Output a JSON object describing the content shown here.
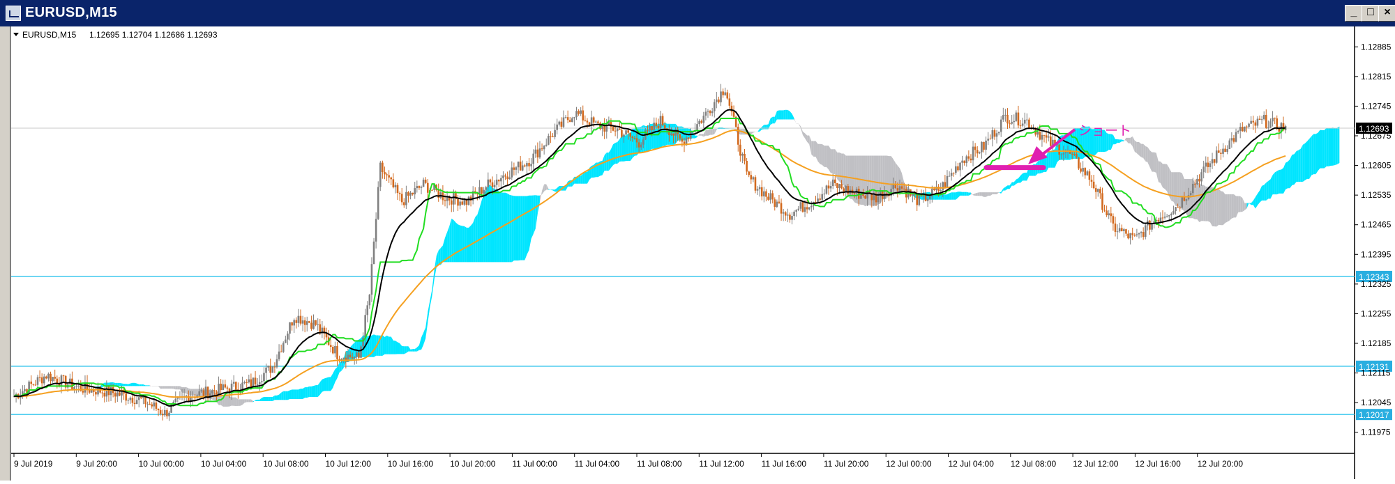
{
  "window": {
    "title": "EURUSD,M15",
    "buttons": [
      "_",
      "□",
      "×"
    ]
  },
  "chart_header": {
    "symbol": "EURUSD,M15",
    "ohlc": "1.12695 1.12704 1.12686 1.12693"
  },
  "annotation": {
    "text": "ショート",
    "color": "#e020b0"
  },
  "colors": {
    "bull_candle": "#808080",
    "bear_candle": "#d2691e",
    "kumo_bull": "#00e5ff",
    "kumo_bear": "#c0c0c4",
    "tenkan": "#000000",
    "kijun": "#22dd22",
    "ma_orange": "#f5a020",
    "hline": "#3dc8ee",
    "current_price_bg": "#000000"
  },
  "chart_data": {
    "type": "candlestick",
    "symbol": "EURUSD",
    "timeframe": "M15",
    "y_axis_ticks": [
      "1.12885",
      "1.12815",
      "1.12745",
      "1.12675",
      "1.12605",
      "1.12535",
      "1.12465",
      "1.12395",
      "1.12325",
      "1.12255",
      "1.12185",
      "1.12115",
      "1.12045",
      "1.11975"
    ],
    "ylim": [
      1.1194,
      1.1292
    ],
    "x_axis_ticks": [
      "9 Jul 2019",
      "9 Jul 20:00",
      "10 Jul 00:00",
      "10 Jul 04:00",
      "10 Jul 08:00",
      "10 Jul 12:00",
      "10 Jul 16:00",
      "10 Jul 20:00",
      "11 Jul 00:00",
      "11 Jul 04:00",
      "11 Jul 08:00",
      "11 Jul 12:00",
      "11 Jul 16:00",
      "11 Jul 20:00",
      "12 Jul 00:00",
      "12 Jul 04:00",
      "12 Jul 08:00",
      "12 Jul 12:00",
      "12 Jul 16:00",
      "12 Jul 20:00"
    ],
    "current_price": "1.12693",
    "horizontal_lines": [
      {
        "price": 1.12343,
        "label": "1.12343"
      },
      {
        "price": 1.12131,
        "label": "1.12131"
      },
      {
        "price": 1.12017,
        "label": "1.12017"
      }
    ],
    "price_path": [
      [
        0,
        1.1206
      ],
      [
        15,
        1.1211
      ],
      [
        30,
        1.1208
      ],
      [
        45,
        1.1207
      ],
      [
        60,
        1.1205
      ],
      [
        70,
        1.1202
      ],
      [
        80,
        1.1206
      ],
      [
        90,
        1.1207
      ],
      [
        100,
        1.1208
      ],
      [
        110,
        1.1209
      ],
      [
        120,
        1.1213
      ],
      [
        130,
        1.1225
      ],
      [
        140,
        1.1223
      ],
      [
        150,
        1.1216
      ],
      [
        160,
        1.1215
      ],
      [
        165,
        1.123
      ],
      [
        170,
        1.126
      ],
      [
        180,
        1.1252
      ],
      [
        190,
        1.1256
      ],
      [
        200,
        1.1253
      ],
      [
        210,
        1.1252
      ],
      [
        220,
        1.1256
      ],
      [
        230,
        1.1259
      ],
      [
        240,
        1.1262
      ],
      [
        250,
        1.1268
      ],
      [
        260,
        1.1273
      ],
      [
        270,
        1.127
      ],
      [
        280,
        1.1269
      ],
      [
        290,
        1.1266
      ],
      [
        300,
        1.1271
      ],
      [
        310,
        1.1266
      ],
      [
        320,
        1.1272
      ],
      [
        330,
        1.1279
      ],
      [
        340,
        1.1258
      ],
      [
        350,
        1.1253
      ],
      [
        360,
        1.1249
      ],
      [
        370,
        1.1252
      ],
      [
        380,
        1.1256
      ],
      [
        390,
        1.1254
      ],
      [
        400,
        1.1253
      ],
      [
        410,
        1.1256
      ],
      [
        420,
        1.1252
      ],
      [
        430,
        1.1255
      ],
      [
        440,
        1.1262
      ],
      [
        450,
        1.1265
      ],
      [
        460,
        1.1272
      ],
      [
        470,
        1.1271
      ],
      [
        480,
        1.1266
      ],
      [
        490,
        1.1263
      ],
      [
        500,
        1.1257
      ],
      [
        510,
        1.1246
      ],
      [
        520,
        1.1243
      ],
      [
        530,
        1.1248
      ],
      [
        540,
        1.1251
      ],
      [
        550,
        1.1258
      ],
      [
        560,
        1.1264
      ],
      [
        570,
        1.1269
      ],
      [
        580,
        1.1271
      ],
      [
        590,
        1.12693
      ]
    ]
  }
}
